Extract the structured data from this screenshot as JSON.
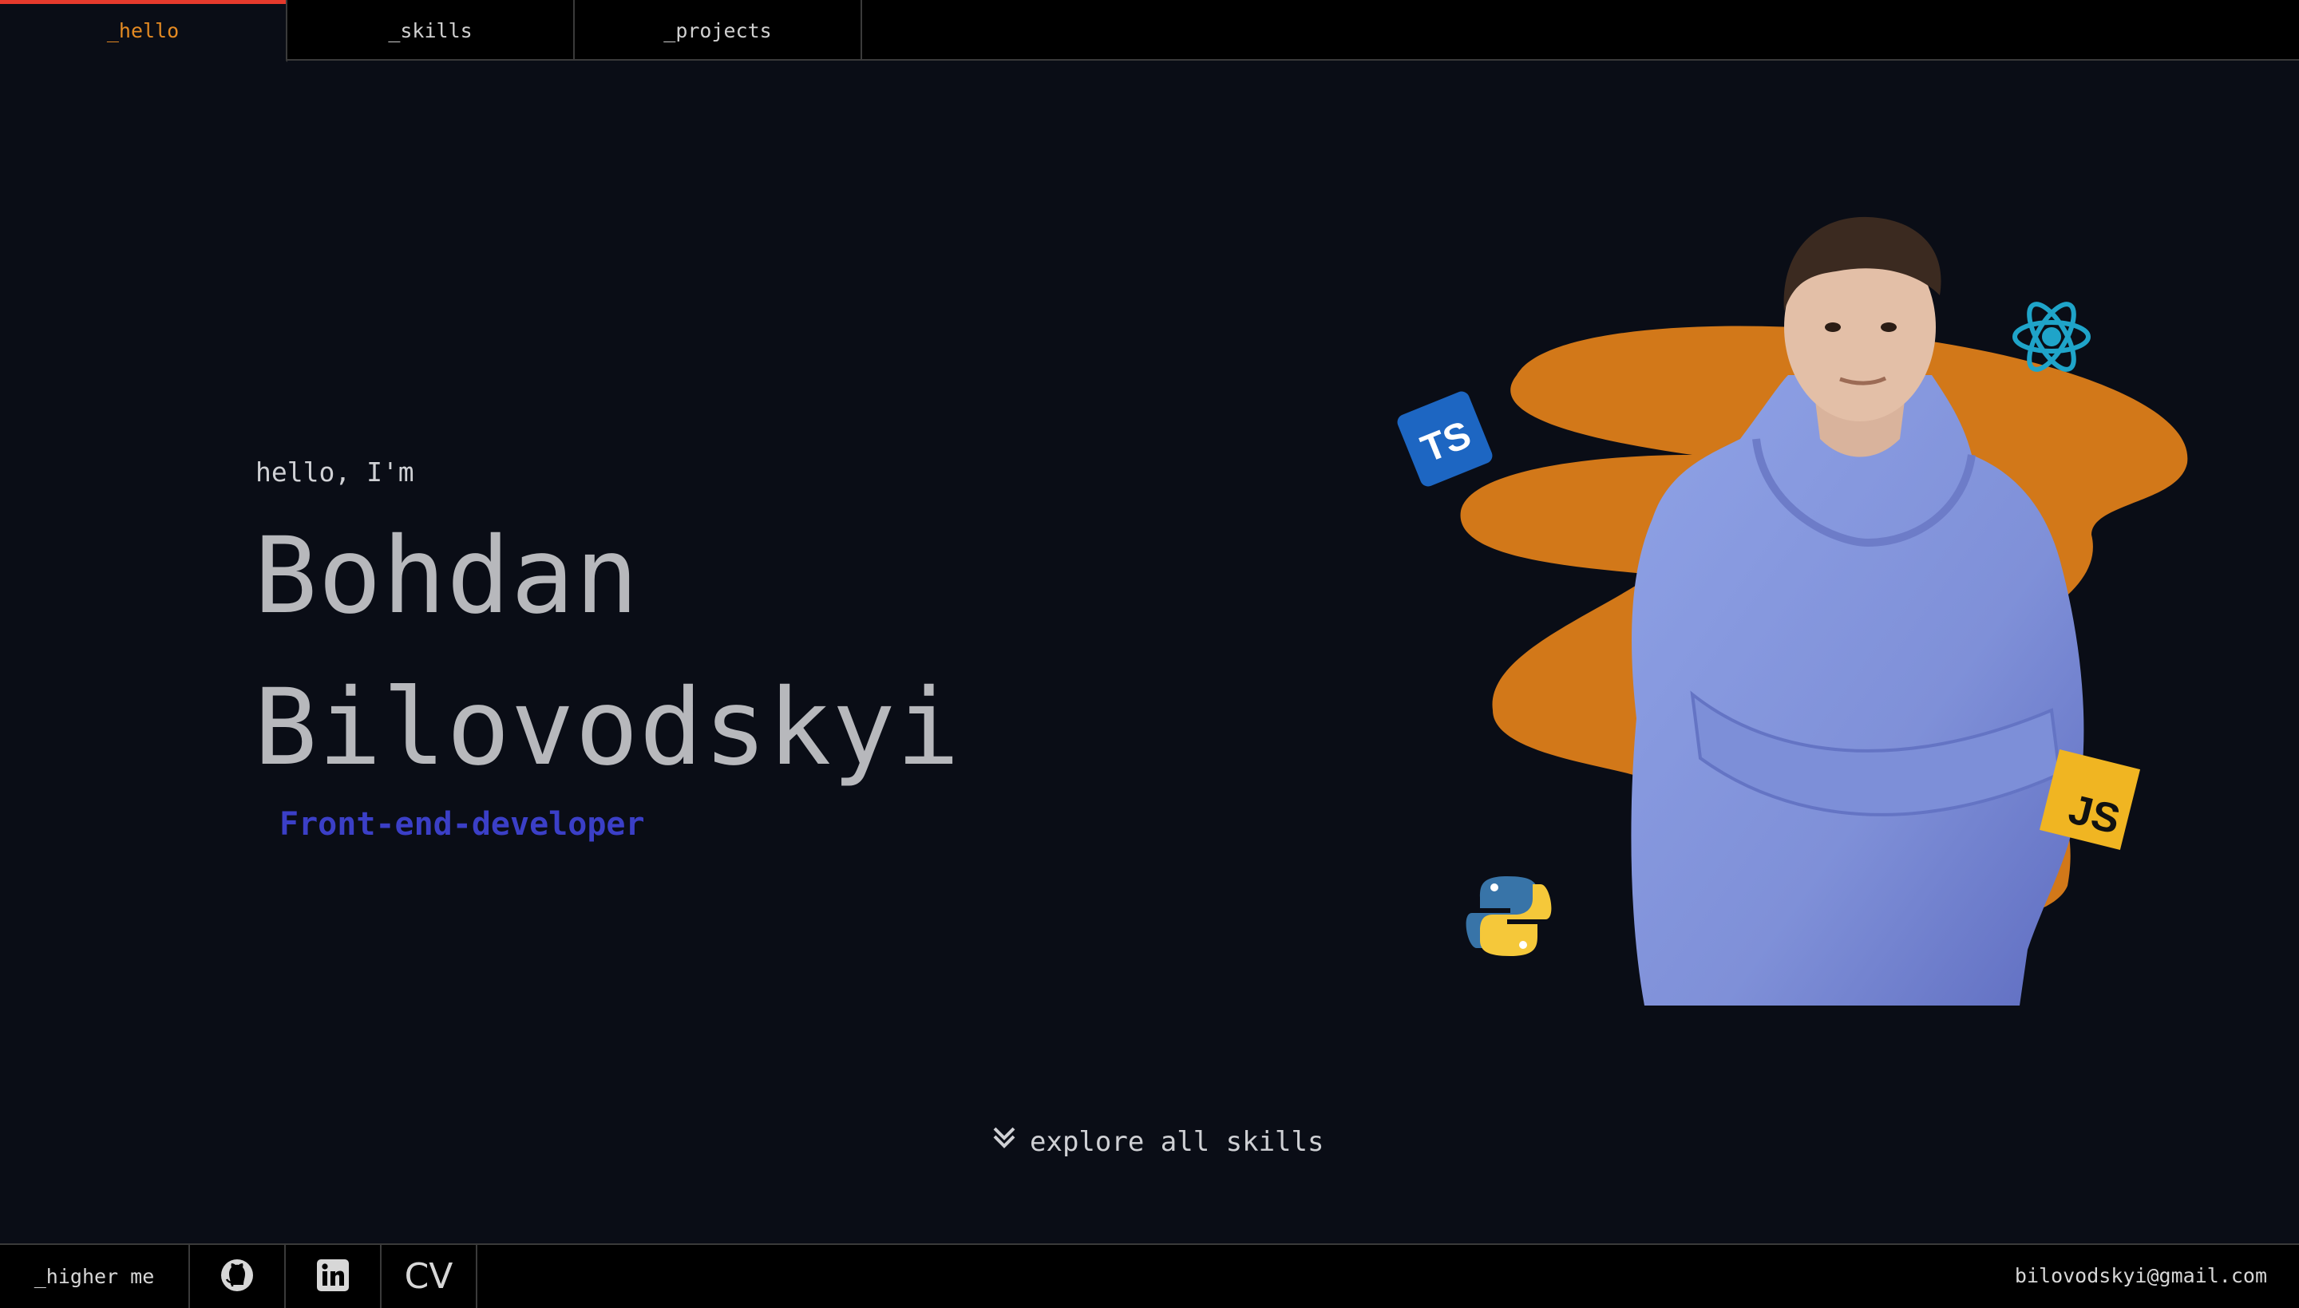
{
  "nav": {
    "tabs": [
      {
        "label": "_hello"
      },
      {
        "label": "_skills"
      },
      {
        "label": "_projects"
      }
    ],
    "active_color": "#e48a22"
  },
  "hero": {
    "greeting": "hello, I'm",
    "first_name": "Bohdan",
    "last_name": "Bilovodskyi",
    "role": "Front-end-developer"
  },
  "explore": {
    "label": "explore all skills",
    "icon": "double-chevron-down-icon"
  },
  "tech_badges": {
    "ts": "TS",
    "js": "JS",
    "react_icon": "react-icon",
    "python_icon": "python-icon"
  },
  "footer": {
    "hire_label": "_higher me",
    "github_icon": "github-icon",
    "linkedin_icon": "linkedin-icon",
    "cv_label": "CV",
    "email": "bilovodskyi@gmail.com"
  },
  "colors": {
    "background": "#0a0d16",
    "accent_orange": "#d27819",
    "active_underline": "#e53a2c",
    "role_blue": "#3b3fc7"
  }
}
